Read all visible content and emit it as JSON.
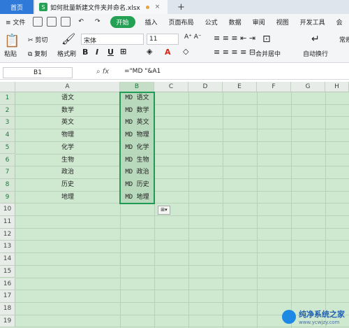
{
  "titlebar": {
    "home_tab": "首页",
    "doc_tab": "如何批量新建文件夹并命名.xlsx",
    "doc_icon": "S",
    "plus": "+"
  },
  "menubar": {
    "file": "文件",
    "start": "开始",
    "items": [
      "插入",
      "页面布局",
      "公式",
      "数据",
      "审阅",
      "视图",
      "开发工具",
      "会"
    ]
  },
  "toolbar": {
    "cut": "剪切",
    "copy": "复制",
    "paste": "粘贴",
    "format_painter": "格式刷",
    "font_name": "宋体",
    "font_size": "11",
    "merge_center": "合并居中",
    "wrap": "自动换行",
    "normal": "常规"
  },
  "formula_bar": {
    "cell_ref": "B1",
    "fx": "fx",
    "formula": "=\"MD \"&A1"
  },
  "sheet": {
    "columns": [
      "A",
      "B",
      "C",
      "D",
      "E",
      "F",
      "G",
      "H"
    ],
    "rows": [
      "1",
      "2",
      "3",
      "4",
      "5",
      "6",
      "7",
      "8",
      "9",
      "10",
      "11",
      "12",
      "13",
      "14",
      "15",
      "16",
      "17",
      "18",
      "19"
    ],
    "colA": [
      "语文",
      "数学",
      "英文",
      "物理",
      "化学",
      "生物",
      "政治",
      "历史",
      "地理"
    ],
    "colB": [
      "MD 语文",
      "MD 数学",
      "MD 英文",
      "MD 物理",
      "MD 化学",
      "MD 生物",
      "MD 政治",
      "MD 历史",
      "MD 地理"
    ]
  },
  "watermark": {
    "title": "纯净系统之家",
    "url": "www.ycwjzy.com"
  }
}
